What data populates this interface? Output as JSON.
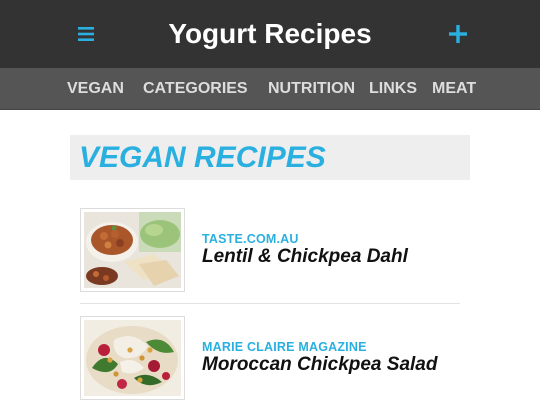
{
  "header": {
    "title": "Yogurt Recipes",
    "menu_icon": "hamburger-menu-icon",
    "add_icon": "plus-icon",
    "accent_color": "#2ab0e0"
  },
  "nav": {
    "items": [
      "VEGAN",
      "CATEGORIES",
      "NUTRITION",
      "LINKS",
      "MEAT"
    ]
  },
  "section": {
    "title": "VEGAN RECIPES"
  },
  "recipes": [
    {
      "source": "TASTE.COM.AU",
      "title": "Lentil & Chickpea Dahl"
    },
    {
      "source": "MARIE CLAIRE MAGAZINE",
      "title": "Moroccan Chickpea Salad"
    }
  ]
}
